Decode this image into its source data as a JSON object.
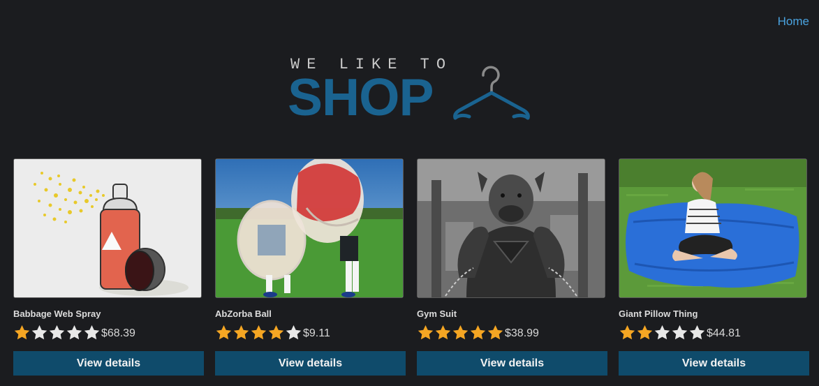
{
  "nav": {
    "home_label": "Home"
  },
  "logo": {
    "top_text": "WE LIKE TO",
    "main_text": "SHOP"
  },
  "colors": {
    "accent": "#4aa3e0",
    "brand": "#1a6390",
    "button_bg": "#0f4b6b",
    "star_filled": "#f5a623",
    "star_empty": "#e8e8e8"
  },
  "products": [
    {
      "name": "Babbage Web Spray",
      "rating": 1,
      "price": "$68.39",
      "button": "View details"
    },
    {
      "name": "AbZorba Ball",
      "rating": 4,
      "price": "$9.11",
      "button": "View details"
    },
    {
      "name": "Gym Suit",
      "rating": 5,
      "price": "$38.99",
      "button": "View details"
    },
    {
      "name": "Giant Pillow Thing",
      "rating": 2,
      "price": "$44.81",
      "button": "View details"
    }
  ]
}
